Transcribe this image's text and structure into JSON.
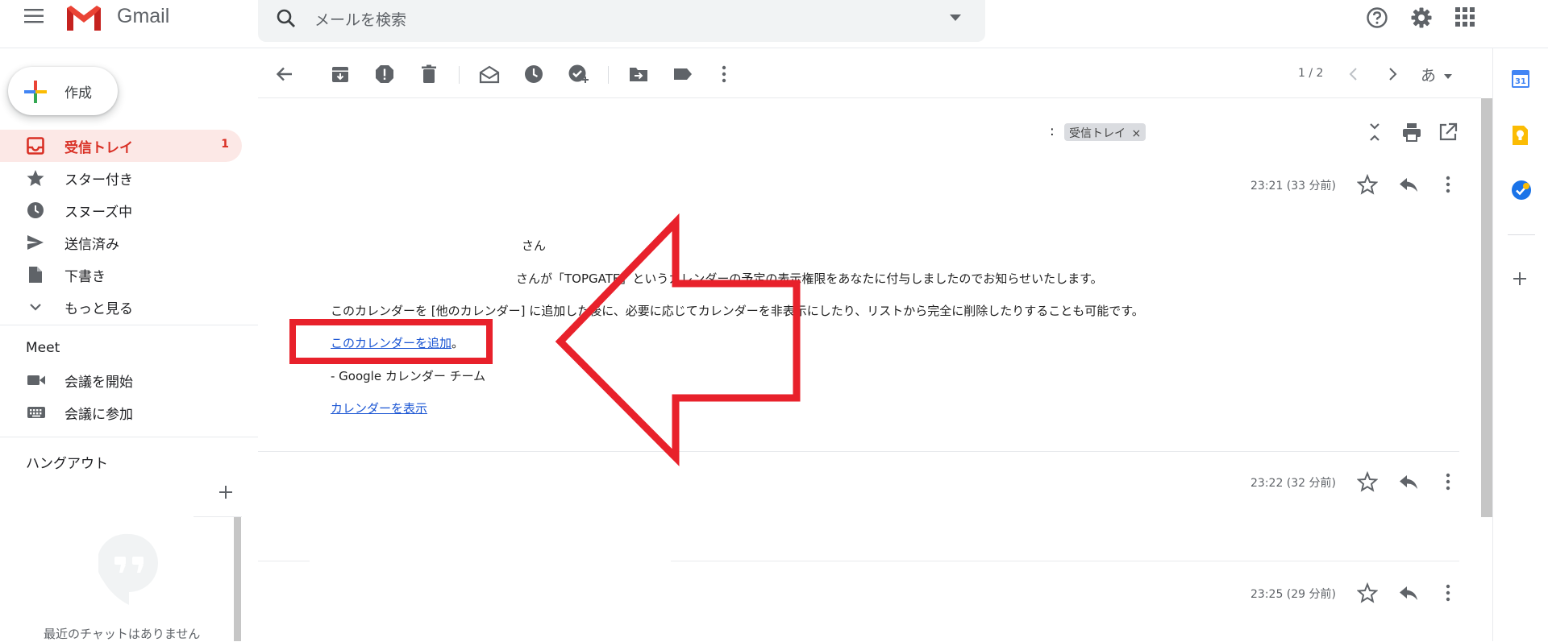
{
  "app": {
    "brand": "Gmail"
  },
  "search": {
    "placeholder": "メールを検索"
  },
  "compose": {
    "label": "作成"
  },
  "nav": {
    "items": [
      {
        "label": "受信トレイ",
        "icon": "inbox-icon",
        "count": "1"
      },
      {
        "label": "スター付き",
        "icon": "star-icon"
      },
      {
        "label": "スヌーズ中",
        "icon": "clock-icon"
      },
      {
        "label": "送信済み",
        "icon": "send-icon"
      },
      {
        "label": "下書き",
        "icon": "file-icon"
      },
      {
        "label": "もっと見る",
        "icon": "chevron-down-icon"
      }
    ]
  },
  "meet": {
    "title": "Meet",
    "items": [
      {
        "label": "会議を開始",
        "icon": "video-icon"
      },
      {
        "label": "会議に参加",
        "icon": "keyboard-icon"
      }
    ]
  },
  "hangouts": {
    "title": "ハングアウト",
    "empty": "最近のチャットはありません"
  },
  "toolbar": {
    "pager": "1 / 2",
    "input_lang": "あ"
  },
  "thread": {
    "subject_sep": ":",
    "label": "受信トレイ",
    "label_close": "×",
    "messages": [
      {
        "time": "23:21 (33 分前)"
      },
      {
        "time": "23:22 (32 分前)"
      },
      {
        "time": "23:25 (29 分前)"
      }
    ],
    "body": {
      "greeting": "さん",
      "line1": "さんが「TOPGATE」というカレンダーの予定の表示権限をあなたに付与しましたのでお知らせいたします。",
      "line2": "このカレンダーを [他のカレンダー] に追加した後に、必要に応じてカレンダーを非表示にしたり、リストから完全に削除したりすることも可能です。",
      "add_link": "このカレンダーを追加",
      "add_link_suffix": "。",
      "signature": "- Google カレンダー チーム",
      "view_link": "カレンダーを表示"
    }
  },
  "side_panel": {
    "calendar_day": "31"
  },
  "colors": {
    "accent_red": "#d93025",
    "annotation_red": "#e8212b",
    "link_blue": "#1a55d3"
  }
}
